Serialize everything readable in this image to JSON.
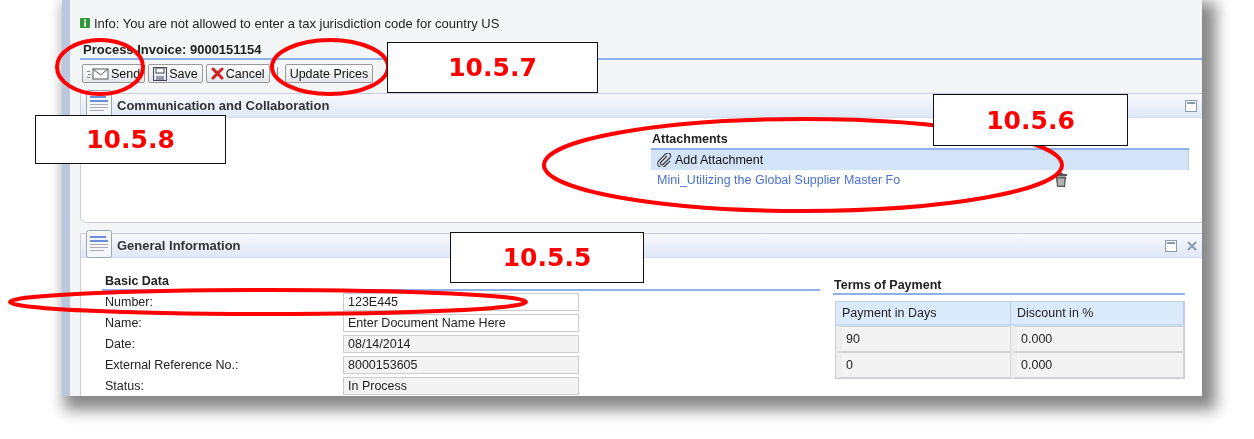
{
  "info_message": {
    "text": "Info: You are not allowed to enter a tax jurisdiction code for country US"
  },
  "page_title": "Process Invoice: 9000151154",
  "toolbar": [
    {
      "kind": "send",
      "label": "Send"
    },
    {
      "kind": "save",
      "label": "Save"
    },
    {
      "kind": "cancel",
      "label": "Cancel"
    },
    {
      "kind": "separator"
    },
    {
      "kind": "text",
      "label": "Update Prices"
    }
  ],
  "communication_panel": {
    "title": "Communication and Collaboration",
    "attachments": {
      "title": "Attachments",
      "add_button": "Add Attachment",
      "files": [
        {
          "name": "Mini_Utilizing the Global Supplier Master Fo"
        }
      ]
    }
  },
  "general_panel": {
    "title": "General Information",
    "basic_data": {
      "title": "Basic Data",
      "fields": [
        {
          "label": "Number:",
          "value": "123E445",
          "read_only": false
        },
        {
          "label": "Name:",
          "value": "Enter Document Name Here",
          "read_only": false
        },
        {
          "label": "Date:",
          "value": "08/14/2014",
          "read_only": true
        },
        {
          "label": "External Reference No.:",
          "value": "8000153605",
          "read_only": true
        },
        {
          "label": "Status:",
          "value": "In Process",
          "read_only": true
        }
      ]
    },
    "terms_of_payment": {
      "title": "Terms of Payment",
      "columns": [
        "Payment in Days",
        "Discount in %"
      ],
      "rows": [
        [
          "90",
          "0.000"
        ],
        [
          "0",
          "0.000"
        ]
      ]
    }
  },
  "annotations": [
    {
      "label": "10.5.7"
    },
    {
      "label": "10.5.8"
    },
    {
      "label": "10.5.6"
    },
    {
      "label": "10.5.5"
    }
  ]
}
